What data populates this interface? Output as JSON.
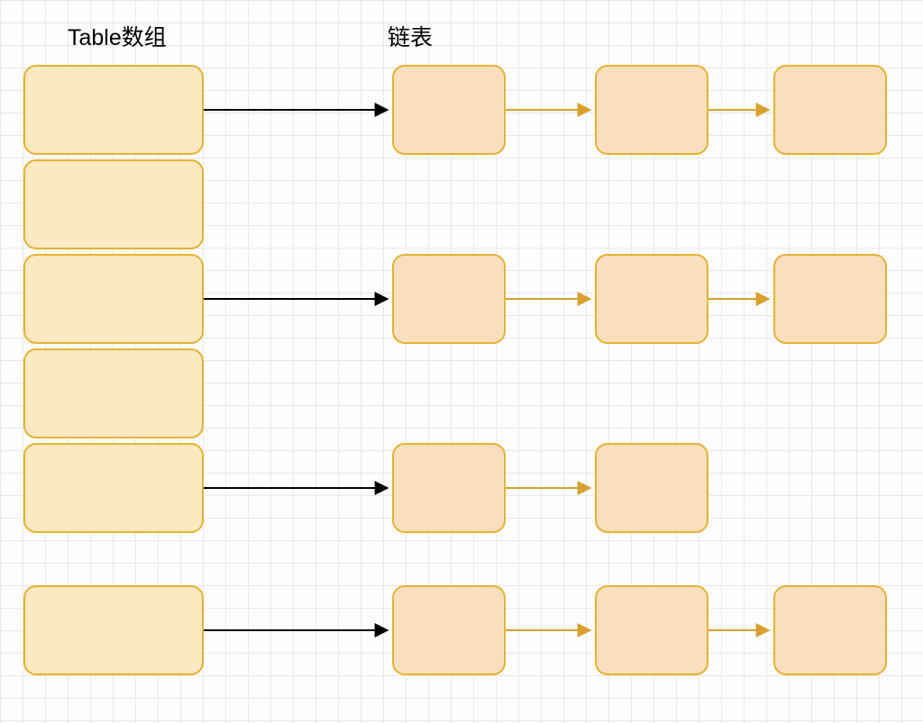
{
  "labels": {
    "table_array": "Table数组",
    "linked_list": "链表"
  },
  "diagram": {
    "table_slots": 6,
    "chains": [
      {
        "from_slot": 0,
        "nodes": 3
      },
      {
        "from_slot": 2,
        "nodes": 3
      },
      {
        "from_slot": 4,
        "nodes": 2
      },
      {
        "from_slot": 5,
        "nodes": 3
      }
    ],
    "colors": {
      "table_fill": "#fce8c1",
      "node_fill": "#fadfbe",
      "border": "#e6b233",
      "arrow_table": "#000000",
      "arrow_chain": "#d9a02e"
    }
  }
}
